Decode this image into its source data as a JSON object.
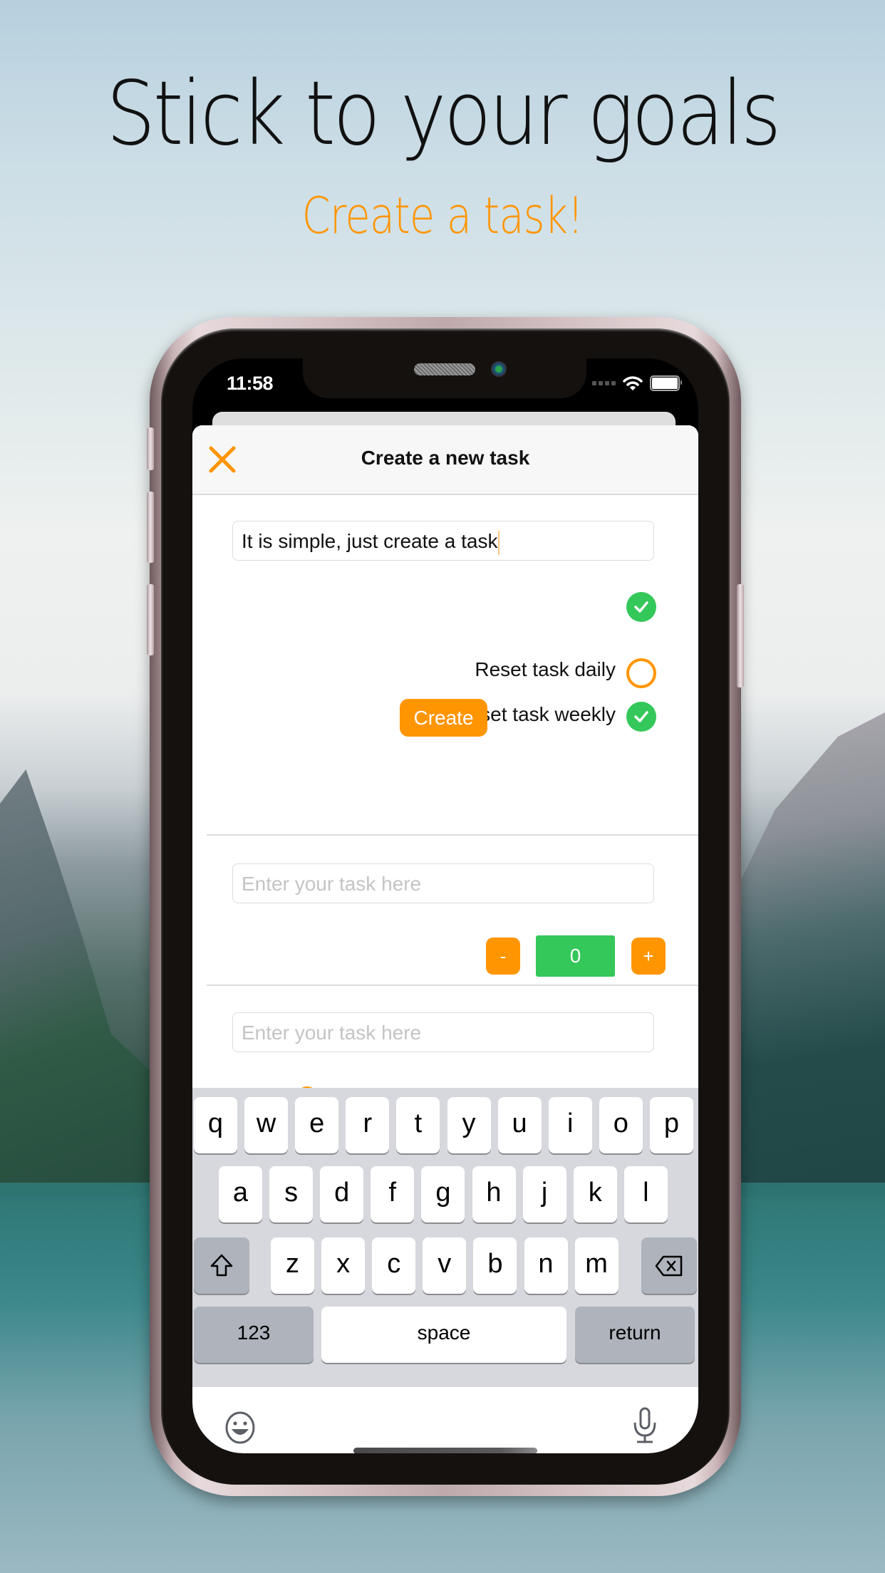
{
  "marketing": {
    "headline": "Stick to your goals",
    "subheadline": "Create a task!"
  },
  "status_bar": {
    "time": "11:58",
    "icons": [
      "signal-icon",
      "wifi-icon",
      "battery-icon"
    ]
  },
  "modal": {
    "title": "Create a new task",
    "close_icon": "close-icon",
    "task_input": {
      "value": "It is simple, just create a task",
      "placeholder": "Enter your task here"
    },
    "completed_toggle": {
      "checked": true
    },
    "options": [
      {
        "label": "Reset task daily",
        "checked": false
      },
      {
        "label": "Reset task weekly",
        "checked": true
      }
    ],
    "create_label": "Create",
    "second_task": {
      "placeholder": "Enter your task here",
      "value": "",
      "stepper": {
        "minus_label": "-",
        "value": "0",
        "plus_label": "+"
      }
    },
    "third_task": {
      "placeholder": "Enter your task here",
      "value": ""
    }
  },
  "keyboard": {
    "row1": [
      "q",
      "w",
      "e",
      "r",
      "t",
      "y",
      "u",
      "i",
      "o",
      "p"
    ],
    "row2": [
      "a",
      "s",
      "d",
      "f",
      "g",
      "h",
      "j",
      "k",
      "l"
    ],
    "row3": [
      "z",
      "x",
      "c",
      "v",
      "b",
      "n",
      "m"
    ],
    "numbers_label": "123",
    "space_label": "space",
    "return_label": "return",
    "shift_icon": "shift-icon",
    "delete_icon": "backspace-icon",
    "emoji_icon": "emoji-icon",
    "mic_icon": "microphone-icon"
  },
  "colors": {
    "accent": "#ff9500",
    "success": "#34c759",
    "keyboard_bg": "#d6d8dd",
    "key_dark": "#aeb3bc"
  }
}
